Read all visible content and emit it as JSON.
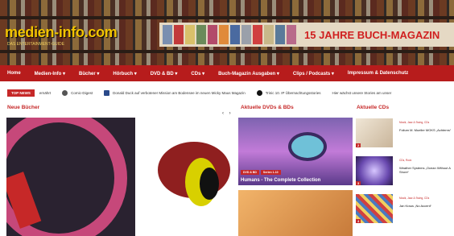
{
  "header": {
    "logo": "medien-info.com",
    "tagline": "DAS ENTERTAINMENT-GUIDE",
    "banner_text": "15 JAHRE BUCH-MAGAZIN"
  },
  "nav": {
    "items": [
      "Home",
      "Medien-Info ▾",
      "Bücher ▾",
      "Hörbuch ▾",
      "DVD & BD ▾",
      "CDs ▾",
      "Buch-Magazin Ausgaben ▾",
      "Clips / Podcasts ▾",
      "Impressum & Datenschutz"
    ]
  },
  "ticker": {
    "label": "TOP NEWS",
    "items": [
      {
        "text": "ernährt",
        "icon": "news-icon"
      },
      {
        "text": "Comic-Digest",
        "icon": "person-icon"
      },
      {
        "text": "Donald Duck auf verbotener Mission am Bodensee im neuen Micky Maus Magazin",
        "icon": "comic-icon"
      },
      {
        "text": "Trinic 10. IP Übernachtungsstories",
        "icon": "person-icon"
      },
      {
        "text": "Hier wächst unsere Stories am unser",
        "icon": "news-icon"
      }
    ]
  },
  "sections": {
    "books_title": "Neue Bücher",
    "dvds_title": "Aktuelle DVDs & BDs",
    "cds_title": "Aktuelle CDs"
  },
  "carousel": {
    "prev": "‹",
    "next": "›"
  },
  "dvd": {
    "tags": [
      "DVD & BD",
      "Serien 1-10"
    ],
    "caption": "Humans - The Complete Collection"
  },
  "cds": [
    {
      "meta": "Musik, Jazz & Swing, CDs",
      "title": "Folium M. Mueller MOKS „Achterns“",
      "num": "2"
    },
    {
      "meta": "CDs, Rock",
      "title": "Weather Systems „Ocean Without A Shore“",
      "num": "3"
    },
    {
      "meta": "Musik, Jazz & Swing, CDs",
      "title": "Jan Kraus „No Accent“",
      "num": "4"
    }
  ],
  "colors": {
    "accent": "#b71c1c",
    "logo": "#f2c400",
    "banner_text": "#d01f1f"
  }
}
